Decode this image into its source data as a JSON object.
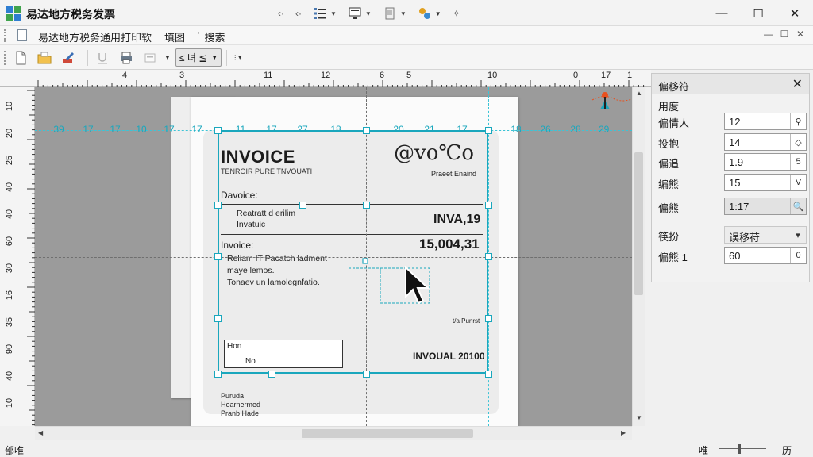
{
  "window": {
    "title": "易达地方税务发票"
  },
  "menu": {
    "items": [
      "易达地方税务通用打印软",
      "填图",
      "搜索"
    ]
  },
  "toolbar": {
    "style_combo_label": "≤ 녀 ≦"
  },
  "ruler": {
    "top": [
      "4",
      "3",
      "11",
      "12",
      "6",
      "5",
      "10",
      "0",
      "17",
      "1"
    ],
    "left": [
      "10",
      "20",
      "25",
      "40",
      "40",
      "60",
      "30",
      "16",
      "35",
      "90",
      "40",
      "10"
    ]
  },
  "canvas": {
    "guide_numbers": [
      "39",
      "17",
      "17",
      "10",
      "17",
      "17",
      "11",
      "17",
      "27",
      "18",
      "20",
      "21",
      "17",
      "18",
      "26",
      "28",
      "29"
    ],
    "marker_number": "29"
  },
  "invoice": {
    "title": "INVOICE",
    "subtitle": "TENROIR PURE TNVOUATI",
    "logo": "@vo℃o",
    "logo_sub": "Praeet Enaind",
    "label_1": "Davoice:",
    "small_1": "Reatratt d erilim\nInvatuic",
    "number_1": "INVA,19",
    "label_2": "Invoice:",
    "number_2": "15,004,31",
    "small_2": "Reliam IT Pacatch ladment\nmaye lemos.\nTonaev un lamolegnfatio.",
    "note": "t/a Punrst",
    "box_row_1": "Hon",
    "box_row_2": "No",
    "total": "INVOUAL 20100",
    "footer": "Puruda\nHearnermed",
    "footer_2": "Pranb Hade"
  },
  "panel": {
    "title": "偏移符",
    "section": "用度",
    "rows": [
      {
        "label": "偏情人",
        "value": "12",
        "button": "⚲"
      },
      {
        "label": "投抱",
        "value": "14",
        "button": "◇"
      },
      {
        "label": "偏追",
        "value": "1.9",
        "button": "5"
      },
      {
        "label": "编熊",
        "value": "15",
        "button": "V"
      },
      {
        "label": "偏熊",
        "value": "1:17",
        "button": "🔍"
      },
      {
        "label": "筷扮",
        "value": "误移苻",
        "button": "▾"
      },
      {
        "label": "偏熊 1",
        "value": "60",
        "button": "0"
      }
    ]
  },
  "status": {
    "left": "部唯",
    "zoom_label": "唯",
    "right": "历"
  },
  "colors": {
    "accent": "#1aa7bd",
    "canvas": "#9b9b9b",
    "marker": "#e8501e"
  }
}
